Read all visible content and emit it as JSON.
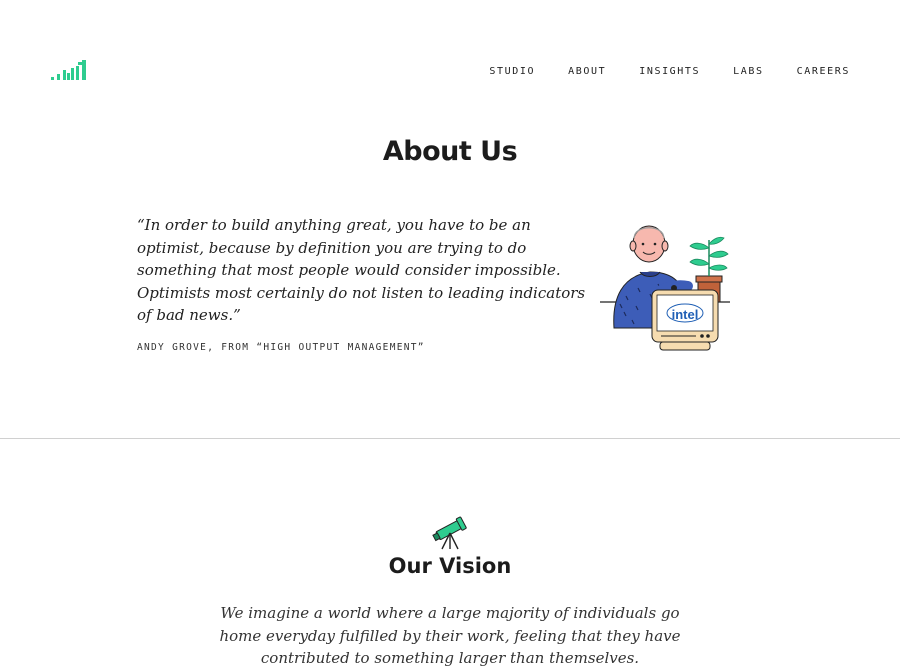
{
  "nav": {
    "items": [
      {
        "label": "STUDIO"
      },
      {
        "label": "ABOUT"
      },
      {
        "label": "INSIGHTS"
      },
      {
        "label": "LABS"
      },
      {
        "label": "CAREERS"
      }
    ]
  },
  "hero": {
    "title": "About Us",
    "quote": "“In order to build anything great, you have to be an optimist, because by definition you are trying to do something that most people would consider impossible. Optimists most certainly do not listen to leading indicators of bad news.”",
    "source": "ANDY GROVE, FROM “HIGH OUTPUT MANAGEMENT”",
    "monitor_brand": "intel"
  },
  "vision": {
    "title": "Our Vision",
    "text": "We imagine a world where a large majority of individuals go home everyday fulfilled by their work, feeling that they have contributed to something larger than themselves."
  },
  "colors": {
    "brand_green": "#2ecc8f",
    "sweater_blue": "#3d5db8",
    "monitor_beige": "#f6dcb0"
  }
}
